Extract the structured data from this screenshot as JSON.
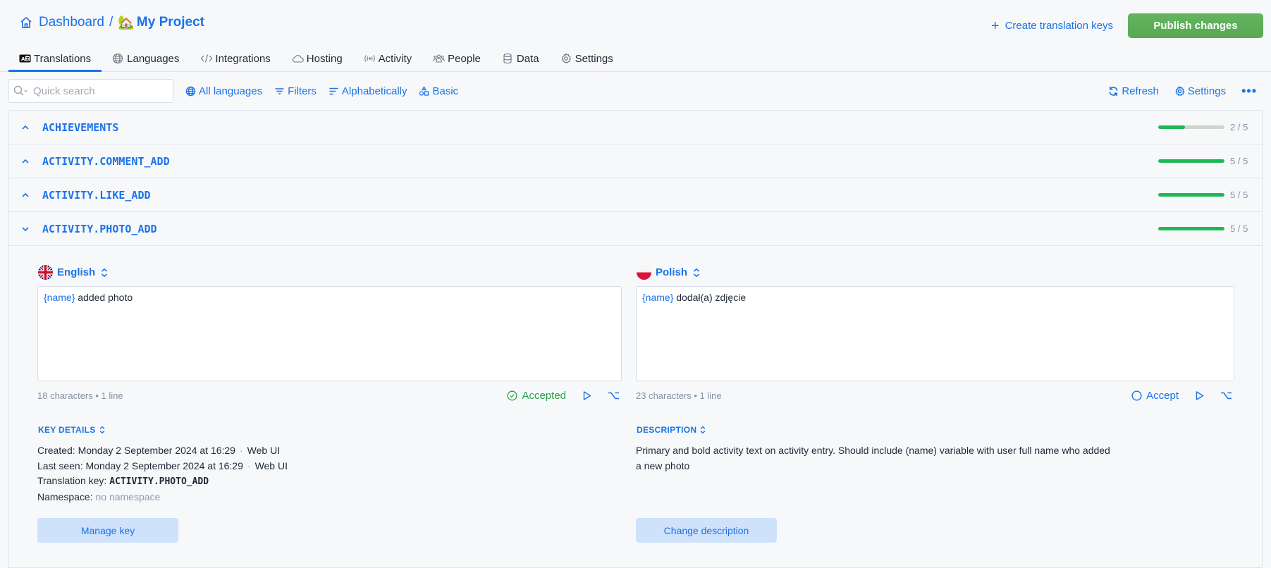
{
  "header": {
    "breadcrumb": {
      "home_label": "Dashboard",
      "separator": "/",
      "project_emoji": "🏡",
      "project_label": "My Project"
    },
    "create_keys_label": "Create translation keys",
    "publish_label": "Publish changes"
  },
  "tabs": [
    {
      "label": "Translations",
      "icon": "translate-icon",
      "active": true
    },
    {
      "label": "Languages",
      "icon": "globe-icon",
      "active": false
    },
    {
      "label": "Integrations",
      "icon": "code-icon",
      "active": false
    },
    {
      "label": "Hosting",
      "icon": "cloud-icon",
      "active": false
    },
    {
      "label": "Activity",
      "icon": "broadcast-icon",
      "active": false
    },
    {
      "label": "People",
      "icon": "people-icon",
      "active": false
    },
    {
      "label": "Data",
      "icon": "database-icon",
      "active": false
    },
    {
      "label": "Settings",
      "icon": "gear-icon",
      "active": false
    }
  ],
  "toolbar": {
    "search_placeholder": "Quick search",
    "search_value": "",
    "all_languages": "All languages",
    "filters": "Filters",
    "sort": "Alphabetically",
    "view_mode": "Basic",
    "refresh": "Refresh",
    "settings": "Settings",
    "more": "•••"
  },
  "keys": [
    {
      "name": "ACHIEVEMENTS",
      "expanded": false,
      "done": 2,
      "total": 5,
      "count_label": "2 / 5"
    },
    {
      "name": "ACTIVITY.COMMENT_ADD",
      "expanded": false,
      "done": 5,
      "total": 5,
      "count_label": "5 / 5"
    },
    {
      "name": "ACTIVITY.LIKE_ADD",
      "expanded": false,
      "done": 5,
      "total": 5,
      "count_label": "5 / 5"
    },
    {
      "name": "ACTIVITY.PHOTO_ADD",
      "expanded": true,
      "done": 5,
      "total": 5,
      "count_label": "5 / 5"
    }
  ],
  "expanded_key": {
    "source": {
      "language": "English",
      "variable": "{name}",
      "text": " added photo",
      "stats": "18 characters • 1 line",
      "state_label": "Accepted"
    },
    "target": {
      "language": "Polish",
      "variable": "{name}",
      "text": " dodał(a) zdjęcie",
      "stats": "23 characters • 1 line",
      "state_label": "Accept"
    },
    "key_details": {
      "title": "KEY DETAILS",
      "created_label": "Created:",
      "created_value": "Monday 2 September 2024 at 16:29",
      "created_source": "Web UI",
      "last_seen_label": "Last seen:",
      "last_seen_value": "Monday 2 September 2024 at 16:29",
      "last_seen_source": "Web UI",
      "key_label": "Translation key:",
      "key_value": "ACTIVITY.PHOTO_ADD",
      "namespace_label": "Namespace:",
      "namespace_value": "no namespace",
      "dot": "·",
      "manage_button": "Manage key"
    },
    "description": {
      "title": "DESCRIPTION",
      "text": "Primary and bold activity text on activity entry. Should include (name) variable with user full name who added a new photo",
      "change_button": "Change description"
    }
  },
  "colors": {
    "accent": "#1a73e8",
    "publish": "#5cae58",
    "progress_fill": "#1db956",
    "progress_track": "#cdd5cd",
    "accepted": "#27a249",
    "soft_button": "#cfe2fc"
  }
}
